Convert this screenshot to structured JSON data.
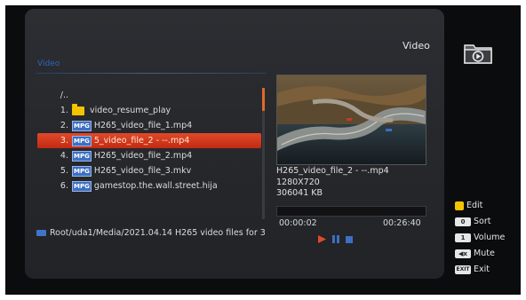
{
  "header": {
    "title": "Video",
    "breadcrumb": "Video"
  },
  "list": {
    "parent": "/..",
    "items": [
      {
        "num": "1.",
        "type": "folder",
        "name": "video_resume_play"
      },
      {
        "num": "2.",
        "type": "MPG",
        "name": "H265_video_file_1.mp4"
      },
      {
        "num": "3.",
        "type": "MPG",
        "name": "5_video_file_2 - --.mp4"
      },
      {
        "num": "4.",
        "type": "MPG",
        "name": "H265_video_file_2.mp4"
      },
      {
        "num": "5.",
        "type": "MPG",
        "name": "H265_video_file_3.mkv"
      },
      {
        "num": "6.",
        "type": "MPG",
        "name": "gamestop.the.wall.street.hija"
      }
    ],
    "selected_index": 2
  },
  "file_info": {
    "name": "H265_video_file_2 - --.mp4",
    "resolution": "1280X720",
    "size": "306041 KB"
  },
  "playback": {
    "elapsed": "00:00:02",
    "total": "00:26:40",
    "progress": 0.0
  },
  "path": "Root/uda1/Media/2021.04.14 H265  video  files for 3",
  "keys": {
    "edit": {
      "badge": "",
      "label": "Edit"
    },
    "sort": {
      "badge": "0",
      "label": "Sort"
    },
    "volume": {
      "badge": "1",
      "label": "Volume"
    },
    "mute": {
      "badge": "◀x",
      "label": "Mute"
    },
    "exit": {
      "badge": "EXIT",
      "label": "Exit"
    }
  },
  "colors": {
    "accent": "#d63a1c",
    "highlight_blue": "#3d6fc4",
    "yellow": "#f4c400"
  }
}
